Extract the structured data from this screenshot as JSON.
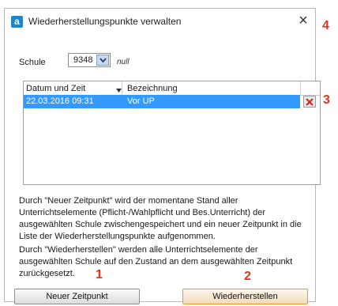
{
  "window": {
    "title": "Wiederherstellungspunkte verwalten",
    "app_icon_letter": "a",
    "close_glyph": "×"
  },
  "school": {
    "label": "Schule",
    "value": "9348",
    "note": "null"
  },
  "table": {
    "columns": [
      "Datum und Zeit",
      "Bezeichnung"
    ],
    "rows": [
      {
        "date": "22.03.2016 09:31",
        "name": "Vor UP"
      }
    ]
  },
  "description": {
    "p1": "Durch \"Neuer Zeitpunkt\" wird der momentane Stand aller Unterrichtselemente (Pflicht-/Wahlpflicht und Bes.Unterricht) der ausgewählten Schule zwischengespeichert und ein neuer Zeitpunkt in die Liste der Wiederherstellungspunkte aufgenommen.",
    "p2": "Durch \"Wiederherstellen\" werden alle Unterrichtselemente der ausgewählten Schule auf den Zustand an dem ausgewählten Zeitpunkt zurückgesetzt."
  },
  "buttons": {
    "new_point": "Neuer Zeitpunkt",
    "restore": "Wiederherstellen"
  },
  "markers": {
    "m1": "1",
    "m2": "2",
    "m3": "3",
    "m4": "4"
  },
  "icons": {
    "app": "app-logo-icon",
    "close": "close-icon",
    "dropdown": "chevron-down-icon",
    "sort": "sort-desc-icon",
    "delete": "delete-icon"
  },
  "colors": {
    "selection": "#3399ff",
    "marker": "#e0321e",
    "app_icon": "#1e86c7"
  }
}
